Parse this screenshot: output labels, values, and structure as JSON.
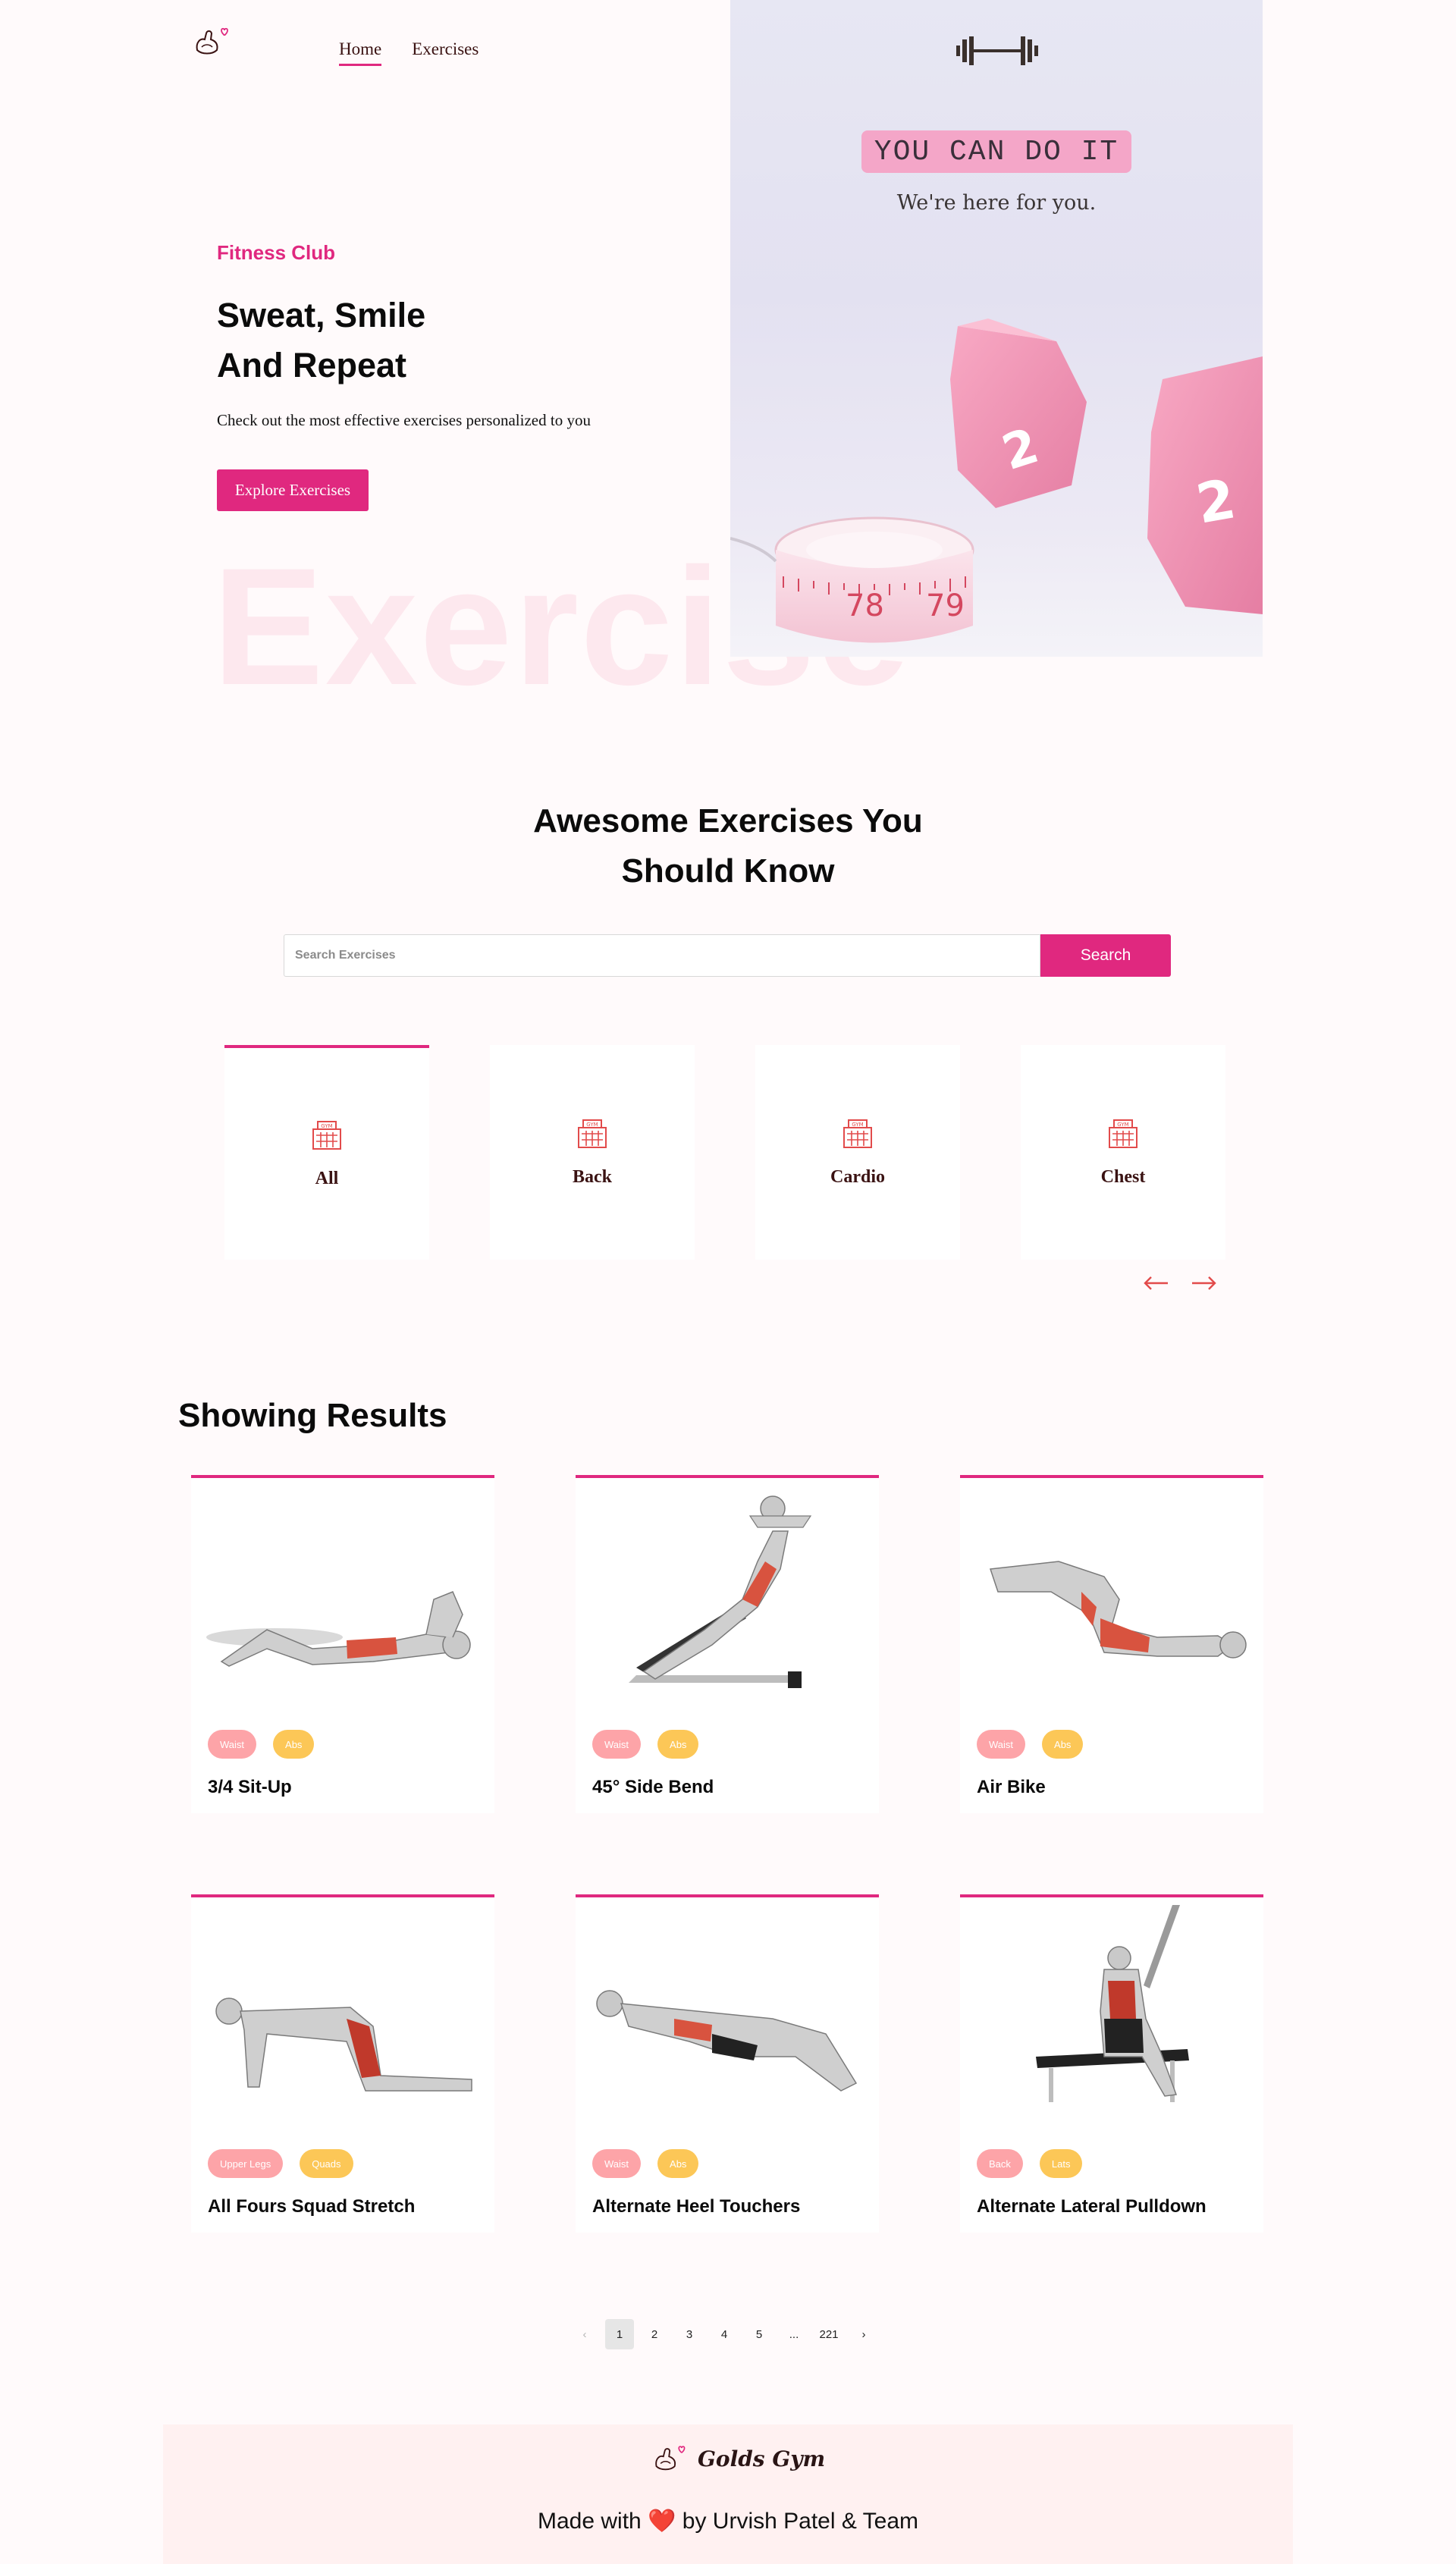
{
  "nav": {
    "home": "Home",
    "exercises": "Exercises"
  },
  "hero": {
    "subtitle": "Fitness Club",
    "title_line1": "Sweat, Smile",
    "title_line2": "And Repeat",
    "description": "Check out the most effective exercises personalized to you",
    "button": "Explore Exercises",
    "watermark": "Exercise"
  },
  "banner": {
    "tagline": "YOU CAN DO IT",
    "message": "We're here for you.",
    "tape_numbers": [
      "78",
      "79"
    ],
    "dumbbell_number": "2"
  },
  "section": {
    "title_line1": "Awesome Exercises You",
    "title_line2": "Should Know",
    "search_placeholder": "Search Exercises",
    "search_button": "Search"
  },
  "categories": [
    {
      "label": "All",
      "active": true
    },
    {
      "label": "Back",
      "active": false
    },
    {
      "label": "Cardio",
      "active": false
    },
    {
      "label": "Chest",
      "active": false
    }
  ],
  "results": {
    "title": "Showing Results",
    "items": [
      {
        "name": "3/4 Sit-Up",
        "tags": [
          "Waist",
          "Abs"
        ]
      },
      {
        "name": "45° Side Bend",
        "tags": [
          "Waist",
          "Abs"
        ]
      },
      {
        "name": "Air Bike",
        "tags": [
          "Waist",
          "Abs"
        ]
      },
      {
        "name": "All Fours Squad Stretch",
        "tags": [
          "Upper Legs",
          "Quads"
        ]
      },
      {
        "name": "Alternate Heel Touchers",
        "tags": [
          "Waist",
          "Abs"
        ]
      },
      {
        "name": "Alternate Lateral Pulldown",
        "tags": [
          "Back",
          "Lats"
        ]
      }
    ]
  },
  "pagination": {
    "pages": [
      "1",
      "2",
      "3",
      "4",
      "5",
      "...",
      "221"
    ],
    "current": "1",
    "prev": "‹",
    "next": "›"
  },
  "footer": {
    "brand": "Golds Gym",
    "credit_before": "Made with",
    "heart": "❤️",
    "credit_after": "by Urvish Patel & Team"
  },
  "colors": {
    "accent": "#e0287f",
    "tag_pink": "#fda4a8",
    "tag_yellow": "#fcc757",
    "category_text": "#3a1212"
  },
  "icons": {
    "logo": "flexing-arm-heart-icon",
    "banner": "dumbbell-icon",
    "category": "gym-building-icon",
    "prev": "arrow-left-icon",
    "next": "arrow-right-icon"
  }
}
